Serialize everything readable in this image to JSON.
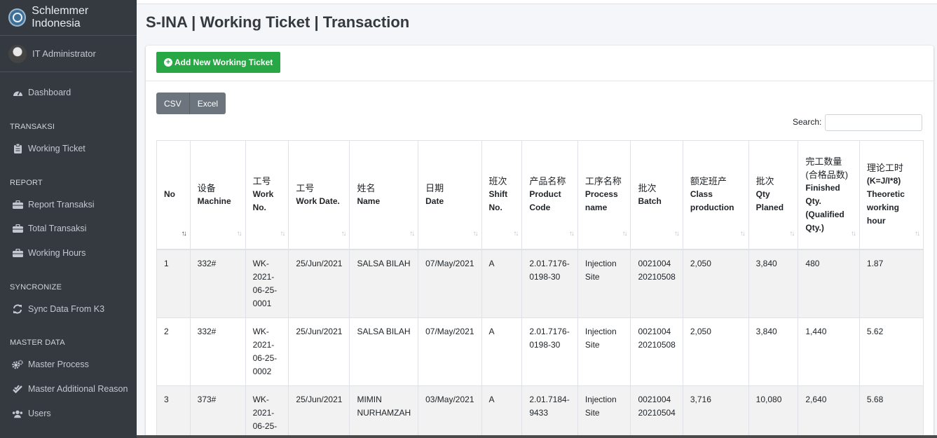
{
  "brand": {
    "name": "Schlemmer Indonesia"
  },
  "user": {
    "name": "IT Administrator"
  },
  "sidebar": {
    "dashboard": "Dashboard",
    "headers": {
      "transaksi": "TRANSAKSI",
      "report": "REPORT",
      "syncronize": "SYNCRONIZE",
      "master": "MASTER DATA"
    },
    "items": {
      "working_ticket": "Working Ticket",
      "report_transaksi": "Report Transaksi",
      "total_transaksi": "Total Transaksi",
      "working_hours": "Working Hours",
      "sync": "Sync Data From K3",
      "master_process": "Master Process",
      "master_reason": "Master Additional Reason",
      "users": "Users"
    }
  },
  "page": {
    "title": "S-INA | Working Ticket | Transaction"
  },
  "toolbar": {
    "add_label": "Add New Working Ticket",
    "csv": "CSV",
    "excel": "Excel",
    "search_label": "Search:",
    "search_value": ""
  },
  "table": {
    "columns": [
      {
        "cn": "",
        "en": "No"
      },
      {
        "cn": "设备",
        "en": "Machine"
      },
      {
        "cn": "工号",
        "en": "Work No."
      },
      {
        "cn": "工号",
        "en": "Work Date."
      },
      {
        "cn": "姓名",
        "en": "Name"
      },
      {
        "cn": "日期",
        "en": "Date"
      },
      {
        "cn": "班次",
        "en": "Shift No."
      },
      {
        "cn": "产品名称",
        "en": "Product Code"
      },
      {
        "cn": "工序名称",
        "en": "Process name"
      },
      {
        "cn": "批次",
        "en": "Batch"
      },
      {
        "cn": "额定班产",
        "en": "Class production"
      },
      {
        "cn": "批次",
        "en": "Qty Planed"
      },
      {
        "cn": "完工数量(合格品数)",
        "en": "Finished Qty. (Qualified Qty.)"
      },
      {
        "cn": "理论工时",
        "en": "(K=J/I*8) Theoretic working hour"
      }
    ],
    "rows": [
      [
        "1",
        "332#",
        "WK-2021-06-25-0001",
        "25/Jun/2021",
        "SALSA BILAH",
        "07/May/2021",
        "A",
        "2.01.7176-0198-30",
        "Injection Site",
        "0021004 20210508",
        "2,050",
        "3,840",
        "480",
        "1.87"
      ],
      [
        "2",
        "332#",
        "WK-2021-06-25-0002",
        "25/Jun/2021",
        "SALSA BILAH",
        "07/May/2021",
        "A",
        "2.01.7176-0198-30",
        "Injection Site",
        "0021004 20210508",
        "2,050",
        "3,840",
        "1,440",
        "5.62"
      ],
      [
        "3",
        "373#",
        "WK-2021-06-25-",
        "25/Jun/2021",
        "MIMIN NURHAMZAH",
        "03/May/2021",
        "A",
        "2.01.7184-9433",
        "Injection Site",
        "0021004 20210504",
        "3,716",
        "10,080",
        "2,640",
        "5.68"
      ]
    ]
  }
}
